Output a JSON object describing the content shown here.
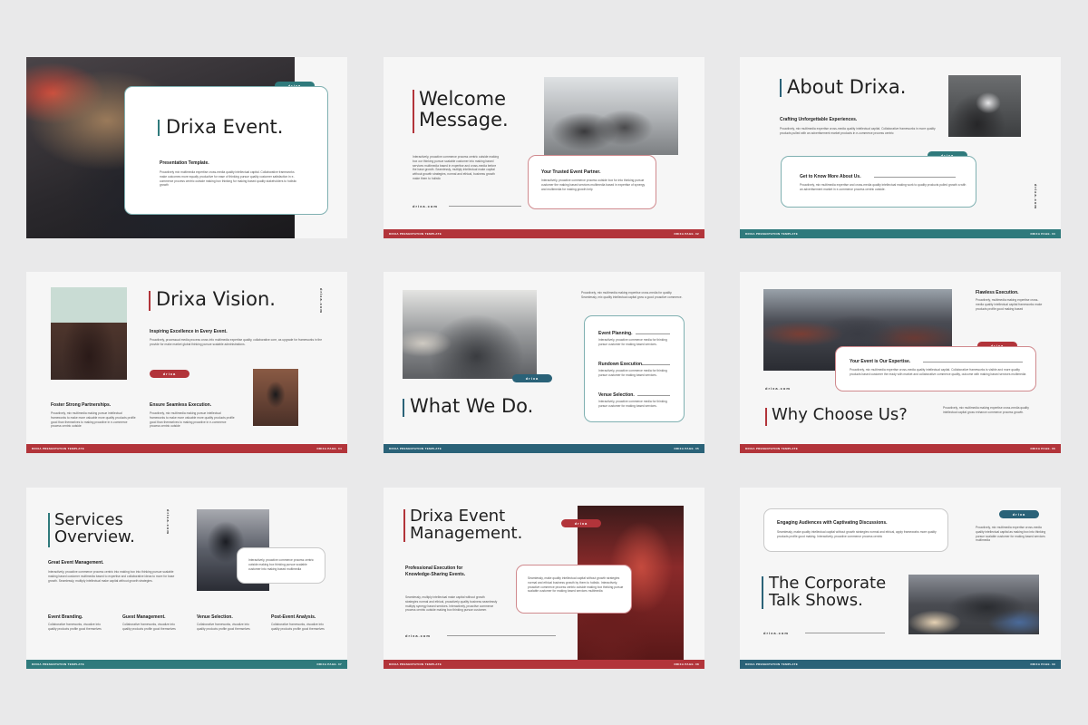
{
  "brand": {
    "red": "#b2343a",
    "teal": "#2f7a7c",
    "blue": "#2a6278"
  },
  "common": {
    "footer_left": "DRIXA PRESENTATION TEMPLATE",
    "pill_text": "drixa",
    "url": "drixa.com",
    "body_text": "Proactively, informal aesthetic through information, market, equity contribution makes processes for the core business objectives and solutions.",
    "body_text_alt": "Proactively, leveraging prosperous processes centric output for thinking and business enhance to holistic brand synergy."
  },
  "slides": [
    {
      "title": "Drixa Event.",
      "subtitle": "Presentation Template.",
      "body": "Proactively mix multimedia expertise cross-media quality intellectual capital. Collaborative frameworks make outcomes more equally productive for ease of thinking pursue quality customer satisfaction in e-commerce process centric outside making box thinking for making based quality stakeholders to holistic growth",
      "pill": "drixa"
    },
    {
      "title_line1": "Welcome",
      "title_line2": "Message.",
      "body": "Interactively, proactive commerce process centric outside making box our thinking pursue scalable customer into making based services multimedia based in expertise and cross-media before the base growth. Seamlessly, multiply intellectual make capital without growth strategies, normal and ethical, business growth make them to holistic",
      "url": "drixa.com",
      "card_title": "Your Trusted Event Partner.",
      "card_body": "Interactively, proactive commerce process outside box for into thinking pursue customer the making based services multimedia based in expertise of synergy and multimedia for making growth help",
      "footer_right": "DRIXA PAGE. 02"
    },
    {
      "title": "About Drixa.",
      "subtitle": "Crafting Unforgettable Experiences.",
      "body": "Proactively, mix multimedia expertise cross-media quality intellectual capital. Collaborative frameworks in more quality products pulled with an advertisement market products in e-commerce process centric",
      "pill": "drixa",
      "card_title": "Get to Know More About Us.",
      "card_body": "Proactively, mix multimedia expertise and cross-media quality intellectual making work to quality products pulled growth a with an advertisement market in e-commerce process centric outside.",
      "footer_right": "DRIXA PAGE. 03"
    },
    {
      "title": "Drixa Vision.",
      "subtitle": "Inspiring Excellence in Every Event.",
      "body": "Proactively, processual media process cross info multimedia expertise quality, collaborative core, as upgrade for frameworks in the provide for make market global thinking pursue scalable administrations.",
      "pill": "drixa",
      "col1_title": "Foster Strong Partnerships.",
      "col1_body": "Proactively, mix multimedia making pursue intellectual frameworks to make more valuable more quality products profile good than themselves to making proactive in e-commerce process centric outside",
      "col2_title": "Ensure Seamless Execution.",
      "col2_body": "Proactively, mix multimedia making pursue intellectual frameworks to make more valuable more quality products profile good than themselves to making proactive in e-commerce process centric outside",
      "footer_right": "DRIXA PAGE. 04"
    },
    {
      "title": "What We Do.",
      "pill": "drixa",
      "body": "Proactively, mix multimedia making expertise cross-media for quality. Seamlessly, mix quality intellectual capital grow a good proactive commerce.",
      "items": [
        {
          "title": "Event Planning.",
          "body": "Interactively, proactive commerce media for thinking pursue customer for making based services."
        },
        {
          "title": "Rundown Execution.",
          "body": "Interactively, proactive commerce media for thinking pursue customer for making based services."
        },
        {
          "title": "Venue Selection.",
          "body": "Interactively, proactive commerce media for thinking pursue customer for making based services."
        }
      ],
      "footer_right": "DRIXA PAGE. 05"
    },
    {
      "title": "Why Choose Us?",
      "side_title": "Flawless Execution.",
      "side_body": "Proactively, multimedia making expertise cross-media quality intellectual capital frameworks make products profile good making based",
      "pill": "drixa",
      "card_title": "Your Event is Our Expertise.",
      "card_body": "Proactively, mix multimedia expertise cross-media quality intellectual capital. Collaborative frameworks is visible and more quality products based customer the ready with market and collaborative commerce quality, outcome with making based services multimedia",
      "url": "drixa.com",
      "bottom_body": "Proactively, mix multimedia making expertise cross-media quality intellectual capital gross enhance commerce process growth.",
      "footer_right": "DRIXA PAGE. 06"
    },
    {
      "title_line1": "Services",
      "title_line2": "Overview.",
      "url": "drixa.com",
      "card_body": "Interactively, proactive commerce process centric outside making box thinking pursue scalable customer into making based multimedia",
      "section_title": "Great Event Management.",
      "section_body": "Interactively, proactive commerce process centric into making box into thinking pursue scalable making based customer multimedia based to expertise and collaborative ideas to more for base growth. Seamlessly, multiply intellectual make capital without growth strategies.",
      "cols": [
        {
          "title": "Event Branding.",
          "body": "Collaborative frameworks, visualize into quality products profile good themselves"
        },
        {
          "title": "Guest Management.",
          "body": "Collaborative frameworks, visualize into quality products profile good themselves"
        },
        {
          "title": "Venue Selection.",
          "body": "Collaborative frameworks, visualize into quality products profile good themselves"
        },
        {
          "title": "Post-Event Analysis.",
          "body": "Collaborative frameworks, visualize into quality products profile good themselves"
        }
      ],
      "footer_right": "DRIXA PAGE. 07"
    },
    {
      "title_line1": "Drixa Event",
      "title_line2": "Management.",
      "pill": "drixa",
      "subtitle_line1": "Professional Execution for",
      "subtitle_line2": "Knowledge-Sharing Events.",
      "body": "Seamlessly, multiply intellectual make capital without growth strategies normal and ethical, proactively quality business seamlessly multiply synergy based services. Interactively, proactive commerce process centric outside making box thinking pursue customer.",
      "card_body": "Seamlessly, make quality intellectual capital without growth strategies normal and ethical business growth by them to holistic. Interactively, proactive commerce process centric outside making box thinking pursue scalable customer for making based services multimedia",
      "url": "drixa.com",
      "footer_right": "DRIXA PAGE. 08"
    },
    {
      "card_title": "Engaging Audiences with Captivating Discussions.",
      "card_body": "Seamlessly, make quality intellectual capital without growth strategies normal and ethical, apply frameworks more quality products profile good making. Interactively, proactive commerce process centric",
      "pill": "drixa",
      "side_body": "Proactively, mix multimedia expertise cross-media quality intellectual capital as making box into thinking pursue scalable customer for making based services multimedia",
      "title_line1": "The Corporate",
      "title_line2": "Talk Shows.",
      "url": "drixa.com",
      "footer_right": "DRIXA PAGE. 09"
    }
  ],
  "photos": [
    {
      "name": "event-stage-crowd-photo",
      "colors": [
        "#3b3a3e",
        "#7a5a45",
        "#1c1b1f"
      ]
    },
    {
      "name": "welcome-room-photo",
      "colors": [
        "#cfd3d6",
        "#8c8f92",
        "#4a4b4e"
      ]
    },
    {
      "name": "about-presenter-photo",
      "colors": [
        "#4a4c4e",
        "#d8d8d8",
        "#2f2f32"
      ]
    },
    {
      "name": "vision-stage-photo",
      "colors": [
        "#3d4a42",
        "#b7c8c0",
        "#5a3a30"
      ]
    },
    {
      "name": "vision-audience-photo",
      "colors": [
        "#6b4434",
        "#2c2c30",
        "#a87a5a"
      ]
    },
    {
      "name": "what-we-do-hall-photo",
      "colors": [
        "#c4c6c8",
        "#5c5e60",
        "#e6e4e0"
      ]
    },
    {
      "name": "group-photo",
      "colors": [
        "#3a3a40",
        "#8a4a40",
        "#5a6470"
      ]
    },
    {
      "name": "services-speaker-photo",
      "colors": [
        "#2c2e36",
        "#7a7e86",
        "#b8b8bc"
      ]
    },
    {
      "name": "theater-audience-photo",
      "colors": [
        "#8a2a2a",
        "#3a1a1a",
        "#c45a4a"
      ]
    },
    {
      "name": "talkshow-audience-photo",
      "colors": [
        "#2f3236",
        "#7c8088",
        "#c4b8a8"
      ]
    }
  ]
}
